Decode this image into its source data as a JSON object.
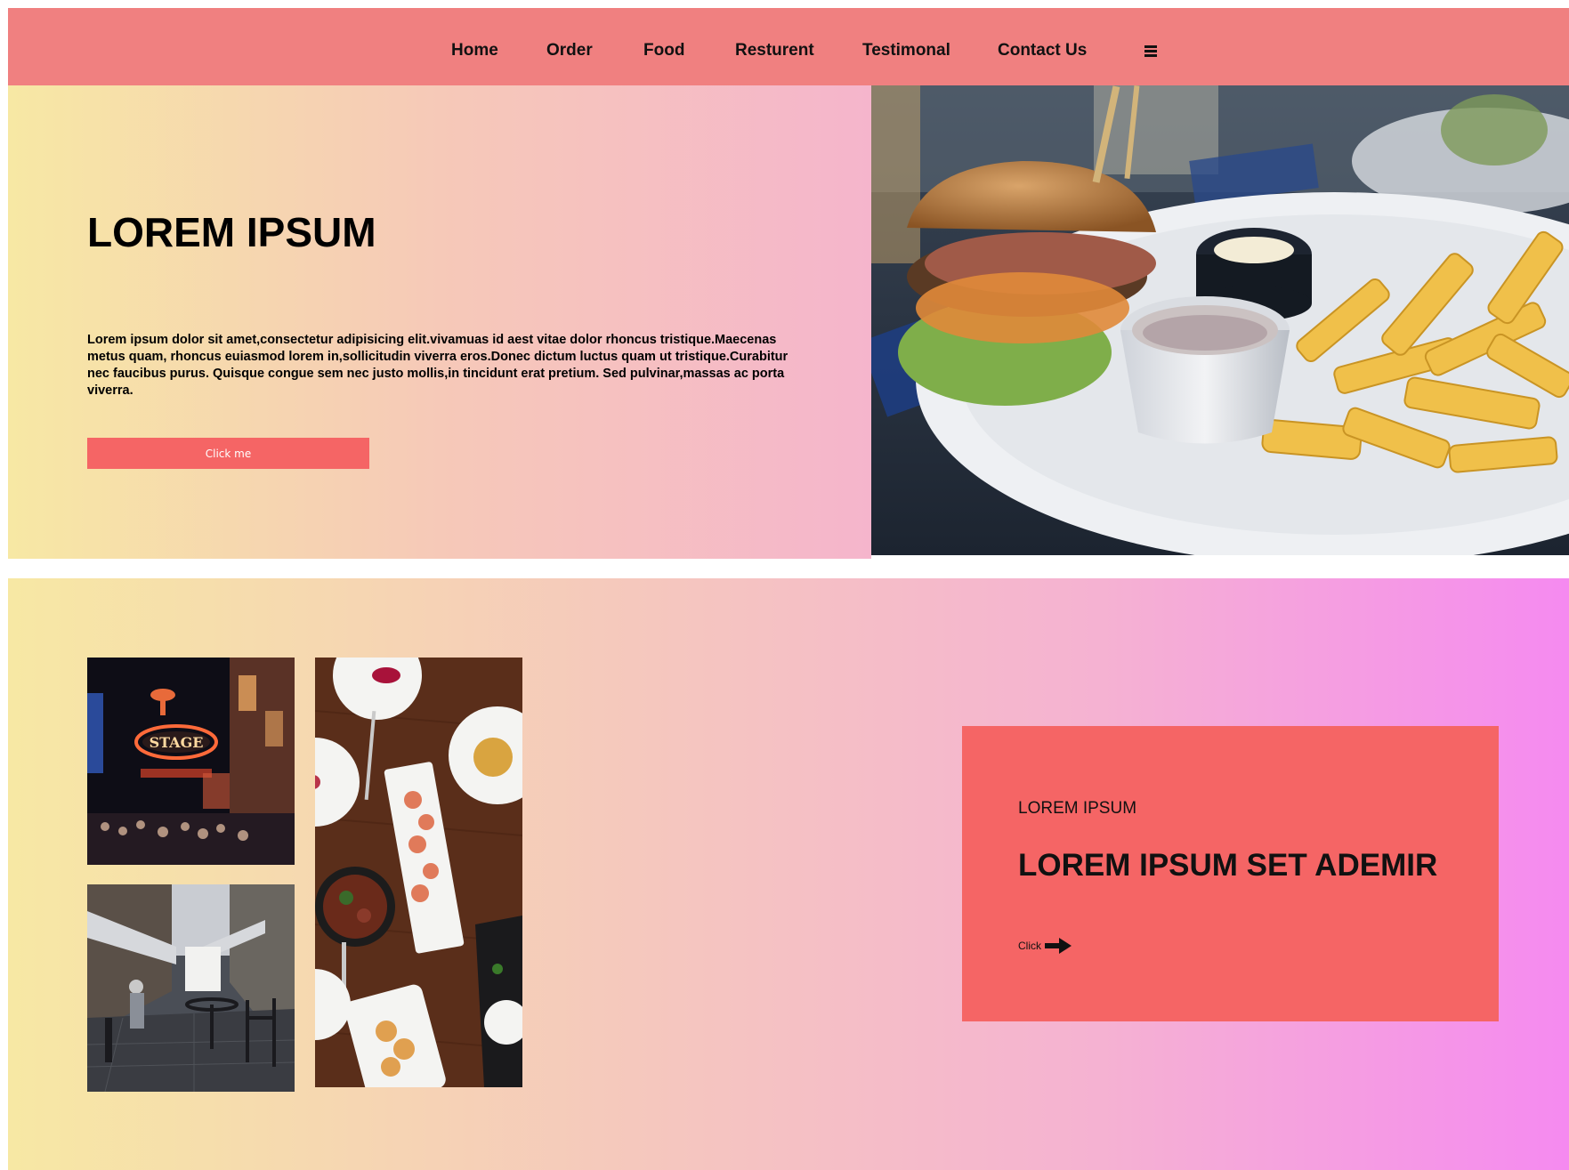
{
  "nav": {
    "items": [
      {
        "label": "Home"
      },
      {
        "label": "Order"
      },
      {
        "label": "Food"
      },
      {
        "label": "Resturent"
      },
      {
        "label": "Testimonal"
      },
      {
        "label": "Contact Us"
      }
    ],
    "menu_icon": "hamburger-menu-icon"
  },
  "hero": {
    "title": "LOREM IPSUM",
    "body": "Lorem ipsum dolor sit amet,consectetur adipisicing elit.vivamuas id aest vitae dolor rhoncus tristique.Maecenas metus quam, rhoncus euiasmod lorem in,sollicitudin viverra eros.Donec dictum luctus quam ut tristique.Curabitur nec faucibus purus. Quisque congue sem nec justo mollis,in tincidunt erat pretium. Sed pulvinar,massas ac porta viverra.",
    "button_label": "Click me",
    "image": "burger-and-fries-photo"
  },
  "gallery": {
    "images": [
      "night-street-stage-sign-photo",
      "cobblestone-cafe-street-photo",
      "food-platters-table-photo"
    ]
  },
  "card": {
    "eyebrow": "LOREM IPSUM",
    "title": "LOREM IPSUM SET ADEMIR",
    "link_label": "Click",
    "link_icon": "arrow-right-icon"
  },
  "colors": {
    "nav_bg": "#f08080",
    "accent": "#f56565",
    "gradient_start": "#f7e8a4",
    "gradient_end": "#f58af0"
  }
}
